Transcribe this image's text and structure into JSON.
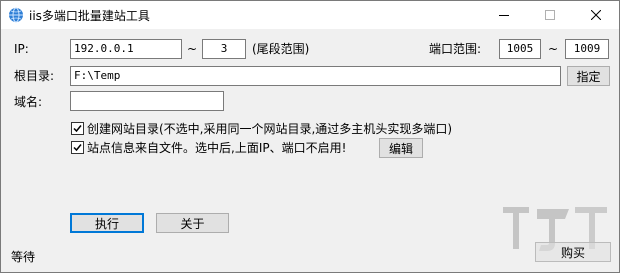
{
  "window": {
    "title": "iis多端口批量建站工具",
    "app_icon": "globe-icon",
    "controls": {
      "minimize": "minimize-icon",
      "maximize": "maximize-icon",
      "close": "close-icon"
    }
  },
  "ip": {
    "label": "IP:",
    "value": "192.0.0.1",
    "tilde": "~",
    "end_value": "3",
    "hint": "(尾段范围)"
  },
  "port": {
    "label": "端口范围:",
    "start_value": "1005",
    "tilde": "~",
    "end_value": "1009"
  },
  "root": {
    "label": "根目录:",
    "value": "F:\\Temp",
    "browse_label": "指定"
  },
  "domain": {
    "label": "域名:",
    "value": ""
  },
  "options": {
    "create_dir": {
      "checked": true,
      "label": "创建网站目录(不选中,采用同一个网站目录,通过多主机头实现多端口)"
    },
    "from_file": {
      "checked": true,
      "label": "站点信息来自文件。选中后,上面IP、端口不启用!",
      "edit_label": "编辑"
    }
  },
  "actions": {
    "run_label": "执行",
    "about_label": "关于"
  },
  "status": {
    "text": "等待"
  },
  "watermark": {
    "button_label": "购买",
    "icon": "download-site-logo"
  }
}
